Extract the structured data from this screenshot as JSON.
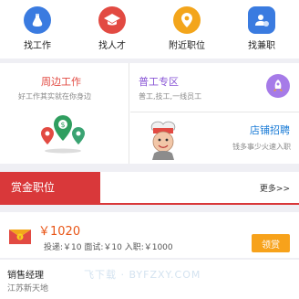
{
  "nav": {
    "items": [
      {
        "label": "找工作",
        "icon": "bottle-icon",
        "color": "#3a7be0"
      },
      {
        "label": "找人才",
        "icon": "graduation-cap-icon",
        "color": "#e24a42"
      },
      {
        "label": "附近职位",
        "icon": "location-pin-icon",
        "color": "#f3a51b"
      },
      {
        "label": "找兼职",
        "icon": "person-badge-icon",
        "color": "#3a7be0"
      }
    ]
  },
  "promo": {
    "nearby": {
      "title": "周边工作",
      "subtitle": "好工作其实就在你身边"
    },
    "general": {
      "title": "普工专区",
      "subtitle": "普工,技工,一线员工"
    },
    "store": {
      "title": "店铺招聘",
      "subtitle": "钱多事少火速入职"
    }
  },
  "section": {
    "title": "赏金职位",
    "more": "更多>>"
  },
  "job": {
    "price": "￥1020",
    "meta": "投递:￥10    面试:￥10    入职:￥1000",
    "claim_label": "领赏",
    "title": "销售经理",
    "location": "江苏新天地"
  },
  "watermark": "飞下载 · BYFZXY.COM",
  "colors": {
    "accent_red": "#d9383a",
    "orange": "#e85516",
    "claim": "#f7a21b",
    "blue": "#1a7bd6",
    "purple": "#8a57d6"
  }
}
